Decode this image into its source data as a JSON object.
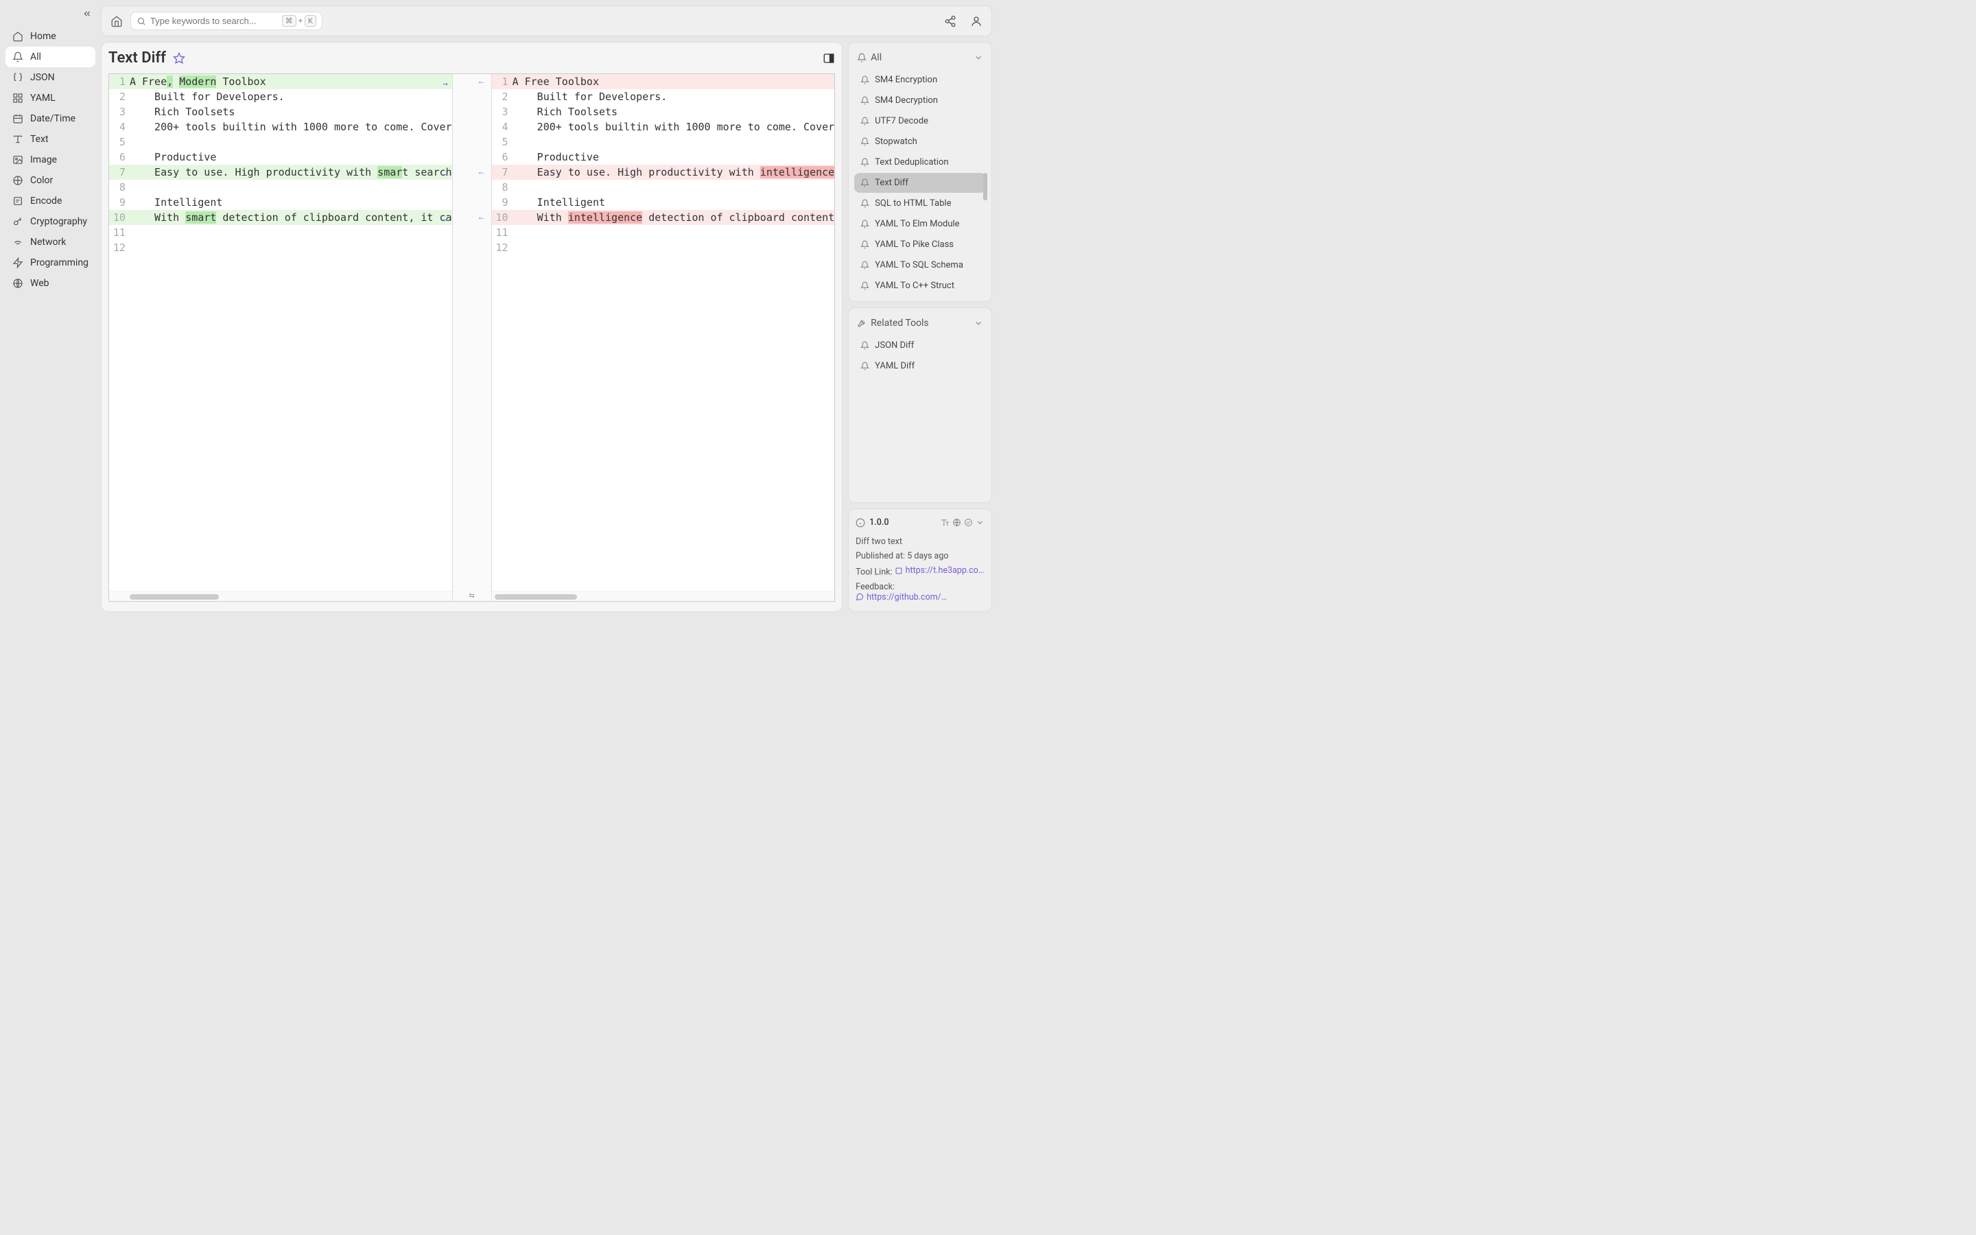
{
  "sidebar": {
    "items": [
      {
        "label": "Home",
        "icon": "home"
      },
      {
        "label": "All",
        "icon": "bell",
        "active": true
      },
      {
        "label": "JSON",
        "icon": "braces"
      },
      {
        "label": "YAML",
        "icon": "grid"
      },
      {
        "label": "Date/Time",
        "icon": "calendar"
      },
      {
        "label": "Text",
        "icon": "text"
      },
      {
        "label": "Image",
        "icon": "image"
      },
      {
        "label": "Color",
        "icon": "color"
      },
      {
        "label": "Encode",
        "icon": "encode"
      },
      {
        "label": "Cryptography",
        "icon": "crypto"
      },
      {
        "label": "Network",
        "icon": "wifi"
      },
      {
        "label": "Programming",
        "icon": "bolt"
      },
      {
        "label": "Web",
        "icon": "globe"
      }
    ]
  },
  "search": {
    "placeholder": "Type keywords to search...",
    "shortcut_mod": "⌘",
    "shortcut_plus": "+",
    "shortcut_key": "K"
  },
  "page": {
    "title": "Text Diff"
  },
  "diff": {
    "left": {
      "lines": [
        {
          "n": 1,
          "segments": [
            {
              "t": "A Free"
            },
            {
              "t": ",",
              "hl": "green"
            },
            {
              "t": " "
            },
            {
              "t": "Modern",
              "hl": "green"
            },
            {
              "t": " Toolbox"
            }
          ],
          "line_hl": "green"
        },
        {
          "n": 2,
          "segments": [
            {
              "t": "    Built for Developers."
            }
          ]
        },
        {
          "n": 3,
          "segments": [
            {
              "t": "    Rich Toolsets"
            }
          ]
        },
        {
          "n": 4,
          "segments": [
            {
              "t": "    200+ tools builtin with 1000 more to come. Cover"
            }
          ]
        },
        {
          "n": 5,
          "segments": [
            {
              "t": ""
            }
          ]
        },
        {
          "n": 6,
          "segments": [
            {
              "t": "    Productive"
            }
          ]
        },
        {
          "n": 7,
          "segments": [
            {
              "t": "    Easy to use. High productivity with "
            },
            {
              "t": "smar",
              "hl": "green"
            },
            {
              "t": "t search"
            }
          ],
          "line_hl": "green"
        },
        {
          "n": 8,
          "segments": [
            {
              "t": ""
            }
          ]
        },
        {
          "n": 9,
          "segments": [
            {
              "t": "    Intelligent"
            }
          ]
        },
        {
          "n": 10,
          "segments": [
            {
              "t": "    With "
            },
            {
              "t": "smart",
              "hl": "green"
            },
            {
              "t": " detection of clipboard content, it ca"
            }
          ],
          "line_hl": "green"
        },
        {
          "n": 11,
          "segments": [
            {
              "t": ""
            }
          ]
        },
        {
          "n": 12,
          "segments": [
            {
              "t": ""
            }
          ]
        }
      ]
    },
    "right": {
      "lines": [
        {
          "n": 1,
          "segments": [
            {
              "t": "A Free Toolbox"
            }
          ],
          "line_hl": "red"
        },
        {
          "n": 2,
          "segments": [
            {
              "t": "    Built for Developers."
            }
          ]
        },
        {
          "n": 3,
          "segments": [
            {
              "t": "    Rich Toolsets"
            }
          ]
        },
        {
          "n": 4,
          "segments": [
            {
              "t": "    200+ tools builtin with 1000 more to come. Cover"
            }
          ]
        },
        {
          "n": 5,
          "segments": [
            {
              "t": ""
            }
          ]
        },
        {
          "n": 6,
          "segments": [
            {
              "t": "    Productive"
            }
          ]
        },
        {
          "n": 7,
          "segments": [
            {
              "t": "    Easy to use. High productivity with "
            },
            {
              "t": "intelligence",
              "hl": "red"
            }
          ],
          "line_hl": "red"
        },
        {
          "n": 8,
          "segments": [
            {
              "t": ""
            }
          ]
        },
        {
          "n": 9,
          "segments": [
            {
              "t": "    Intelligent"
            }
          ]
        },
        {
          "n": 10,
          "segments": [
            {
              "t": "    With "
            },
            {
              "t": "intelligence",
              "hl": "red"
            },
            {
              "t": " detection of clipboard content"
            }
          ],
          "line_hl": "red"
        },
        {
          "n": 11,
          "segments": [
            {
              "t": ""
            }
          ]
        },
        {
          "n": 12,
          "segments": [
            {
              "t": ""
            }
          ]
        }
      ]
    }
  },
  "rightcol": {
    "all_label": "All",
    "tools": [
      {
        "label": "SM4 Encryption"
      },
      {
        "label": "SM4 Decryption"
      },
      {
        "label": "UTF7 Decode"
      },
      {
        "label": "Stopwatch"
      },
      {
        "label": "Text Deduplication"
      },
      {
        "label": "Text Diff",
        "active": true
      },
      {
        "label": "SQL to HTML Table"
      },
      {
        "label": "YAML To Elm Module"
      },
      {
        "label": "YAML To Pike Class"
      },
      {
        "label": "YAML To SQL Schema"
      },
      {
        "label": "YAML To C++ Struct"
      }
    ],
    "related_label": "Related Tools",
    "related": [
      {
        "label": "JSON Diff"
      },
      {
        "label": "YAML Diff"
      }
    ],
    "info": {
      "version": "1.0.0",
      "desc": "Diff two text",
      "published_label": "Published at:",
      "published_value": "5 days ago",
      "toollink_label": "Tool Link:",
      "toollink_value": "https://t.he3app.co…",
      "feedback_label": "Feedback:",
      "feedback_value": "https://github.com/…"
    }
  }
}
